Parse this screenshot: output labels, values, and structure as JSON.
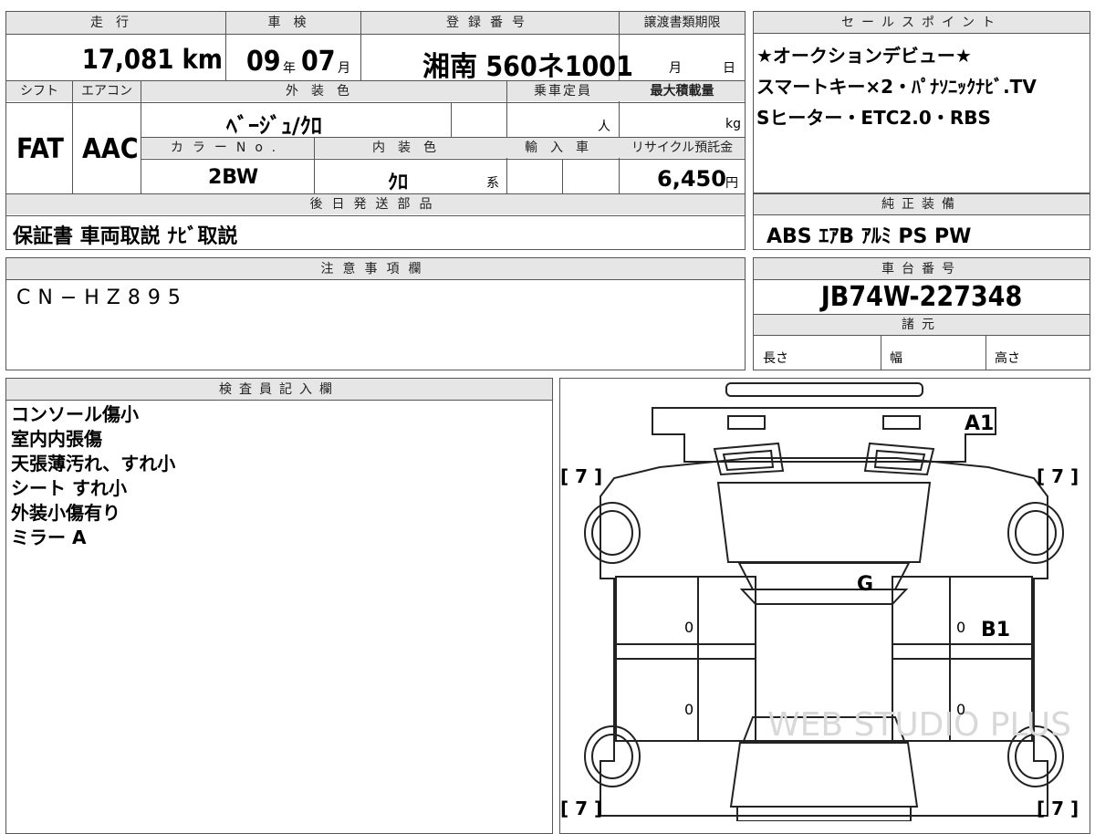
{
  "header": {
    "mileage_label": "走行",
    "inspection_label": "車検",
    "reg_label": "登録番号",
    "transfer_label": "譲渡書類期限",
    "sales_label": "セールスポイント"
  },
  "values": {
    "mileage": "17,081 km",
    "insp_year": "09",
    "insp_year_unit": "年",
    "insp_month": "07",
    "insp_month_unit": "月",
    "reg_number": "湘南 560ネ1001",
    "transfer_month_unit": "月",
    "transfer_day_unit": "日"
  },
  "row2": {
    "shift_label": "シフト",
    "ac_label": "エアコン",
    "ext_color_label": "外装色",
    "capacity_label": "乗車定員",
    "load_label": "最大積載量",
    "shift": "FAT",
    "ac": "AAC",
    "ext_color": "ﾍﾞｰｼﾞｭ/ｸﾛ",
    "capacity_unit": "人",
    "load_unit": "kg"
  },
  "row3": {
    "color_no_label": "カラーNo.",
    "int_color_label": "内装色",
    "import_label": "輸入車",
    "recycle_label": "リサイクル預託金",
    "color_no": "2BW",
    "int_color": "ｸﾛ",
    "int_color_unit": "系",
    "recycle": "6,450",
    "recycle_unit": "円"
  },
  "later_parts": {
    "label": "後日発送部品",
    "value": "保証書 車両取説 ﾅﾋﾞ取説"
  },
  "sales_points": {
    "lines": [
      "★オークションデビュー★",
      "スマートキー×2・ﾊﾟﾅｿﾆｯｸﾅﾋﾞ.TV",
      "Sヒーター・ETC2.0・RBS"
    ]
  },
  "genuine": {
    "label": "純正装備",
    "value": "ABS ｴｱB ｱﾙﾐ PS PW"
  },
  "notes": {
    "label": "注意事項欄",
    "value": "CN−HZ895"
  },
  "chassis": {
    "label": "車台番号",
    "value": "JB74W-227348"
  },
  "specs": {
    "label": "諸元",
    "length": "長さ",
    "width": "幅",
    "height": "高さ"
  },
  "inspector": {
    "label": "検査員記入欄",
    "lines": [
      "コンソール傷小",
      "室内内張傷",
      "天張薄汚れ、すれ小",
      "シート すれ小",
      "外装小傷有り",
      "ミラー A"
    ]
  },
  "diagram": {
    "a1": "A1",
    "g": "G",
    "b1": "B1",
    "tire_tl": "[ 7 ]",
    "tire_tr": "[ 7 ]",
    "tire_bl": "[ 7 ]",
    "tire_br": "[ 7 ]",
    "zero_1": "0",
    "zero_2": "0",
    "zero_3": "0",
    "zero_4": "0",
    "watermark": "WEB STUDIO PLUS"
  }
}
